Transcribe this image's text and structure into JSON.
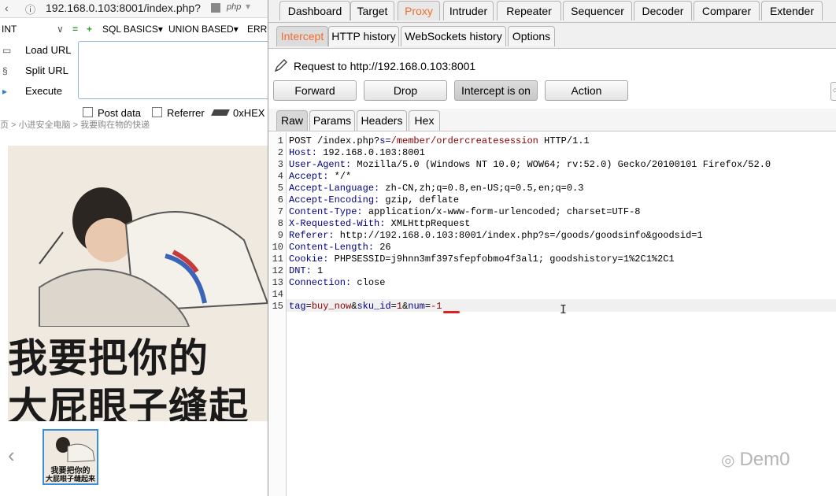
{
  "browser": {
    "url": "192.168.0.103:8001/index.php?",
    "php_badge": "php",
    "hackbar": {
      "select_value": "INT",
      "menus": [
        "SQL BASICS",
        "UNION BASED",
        "ERRO"
      ],
      "actions": [
        "Load URL",
        "Split URL",
        "Execute"
      ],
      "checkboxes": [
        "Post data",
        "Referrer"
      ],
      "hex_label": "0xHEX"
    },
    "breadcrumb": "页 > 小进安全电脑 > 我要购在物的快递",
    "meme": {
      "line1": "我要把你的",
      "line2": "大屁眼子缝起",
      "thumb_line1": "我要把你的",
      "thumb_line2": "大屁眼子缝起来"
    },
    "prev_arrow": "‹"
  },
  "burp": {
    "top_tabs": [
      "Dashboard",
      "Target",
      "Proxy",
      "Intruder",
      "Repeater",
      "Sequencer",
      "Decoder",
      "Comparer",
      "Extender"
    ],
    "active_top_tab": "Proxy",
    "sub_tabs": [
      "Intercept",
      "HTTP history",
      "WebSockets history",
      "Options"
    ],
    "active_sub_tab": "Intercept",
    "request_to": "Request to http://192.168.0.103:8001",
    "buttons": [
      "Forward",
      "Drop",
      "Intercept is on",
      "Action"
    ],
    "view_tabs": [
      "Raw",
      "Params",
      "Headers",
      "Hex"
    ],
    "active_view_tab": "Raw",
    "request_lines": [
      {
        "n": "1",
        "text": "POST /index.php?s=/member/ordercreatesession HTTP/1.1"
      },
      {
        "n": "2",
        "text": "Host: 192.168.0.103:8001"
      },
      {
        "n": "3",
        "text": "User-Agent: Mozilla/5.0 (Windows NT 10.0; WOW64; rv:52.0) Gecko/20100101 Firefox/52.0"
      },
      {
        "n": "4",
        "text": "Accept: */*"
      },
      {
        "n": "5",
        "text": "Accept-Language: zh-CN,zh;q=0.8,en-US;q=0.5,en;q=0.3"
      },
      {
        "n": "6",
        "text": "Accept-Encoding: gzip, deflate"
      },
      {
        "n": "7",
        "text": "Content-Type: application/x-www-form-urlencoded; charset=UTF-8"
      },
      {
        "n": "8",
        "text": "X-Requested-With: XMLHttpRequest"
      },
      {
        "n": "9",
        "text": "Referer: http://192.168.0.103:8001/index.php?s=/goods/goodsinfo&goodsid=1"
      },
      {
        "n": "10",
        "text": "Content-Length: 26"
      },
      {
        "n": "11",
        "text": "Cookie: PHPSESSID=j9hnn3mf397sfepfobmo4f3al1; goodshistory=1%2C1%2C1"
      },
      {
        "n": "12",
        "text": "DNT: 1"
      },
      {
        "n": "13",
        "text": "Connection: close"
      },
      {
        "n": "14",
        "text": ""
      },
      {
        "n": "15",
        "text": "tag=buy_now&sku_id=1&num=-1"
      }
    ],
    "watermark": "Dem0"
  },
  "colors": {
    "accent_orange": "#f06d2d",
    "header_key": "#000080",
    "header_value": "#8b0000",
    "highlight_red": "#e02020"
  }
}
